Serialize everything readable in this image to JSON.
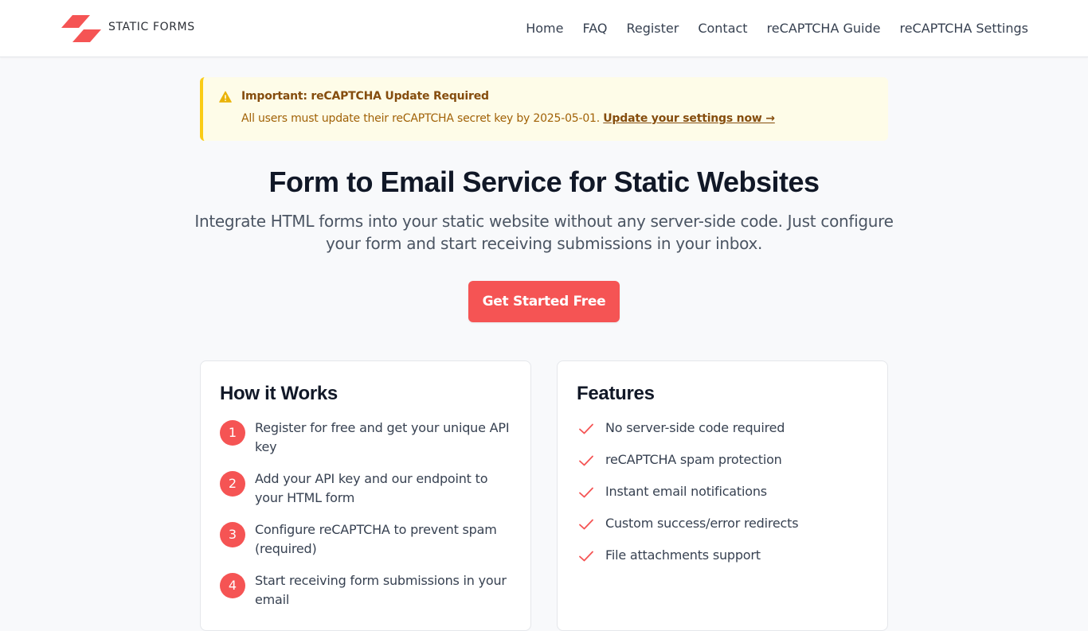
{
  "header": {
    "logo_text": "STATIC FORMS",
    "nav": [
      {
        "label": "Home"
      },
      {
        "label": "FAQ"
      },
      {
        "label": "Register"
      },
      {
        "label": "Contact"
      },
      {
        "label": "reCAPTCHA Guide"
      },
      {
        "label": "reCAPTCHA Settings"
      }
    ]
  },
  "alert": {
    "icon": "warning-icon",
    "title": "Important: reCAPTCHA Update Required",
    "body": "All users must update their reCAPTCHA secret key by 2025-05-01.",
    "link_label": "Update your settings now →"
  },
  "hero": {
    "title": "Form to Email Service for Static Websites",
    "subtitle": "Integrate HTML forms into your static website without any server-side code. Just configure your form and start receiving submissions in your inbox.",
    "cta_label": "Get Started Free"
  },
  "how_it_works": {
    "title": "How it Works",
    "steps": [
      {
        "number": "1",
        "text": "Register for free and get your unique API key"
      },
      {
        "number": "2",
        "text": "Add your API key and our endpoint to your HTML form"
      },
      {
        "number": "3",
        "text": "Configure reCAPTCHA to prevent spam (required)"
      },
      {
        "number": "4",
        "text": "Start receiving form submissions in your email"
      }
    ]
  },
  "features": {
    "title": "Features",
    "items": [
      {
        "icon": "check-icon",
        "text": "No server-side code required"
      },
      {
        "icon": "check-icon",
        "text": "reCAPTCHA spam protection"
      },
      {
        "icon": "check-icon",
        "text": "Instant email notifications"
      },
      {
        "icon": "check-icon",
        "text": "Custom success/error redirects"
      },
      {
        "icon": "check-icon",
        "text": "File attachments support"
      }
    ]
  },
  "colors": {
    "brand": "#f55454",
    "alert_bg": "#fefce8",
    "alert_border": "#facc15",
    "alert_text": "#854d0e"
  }
}
